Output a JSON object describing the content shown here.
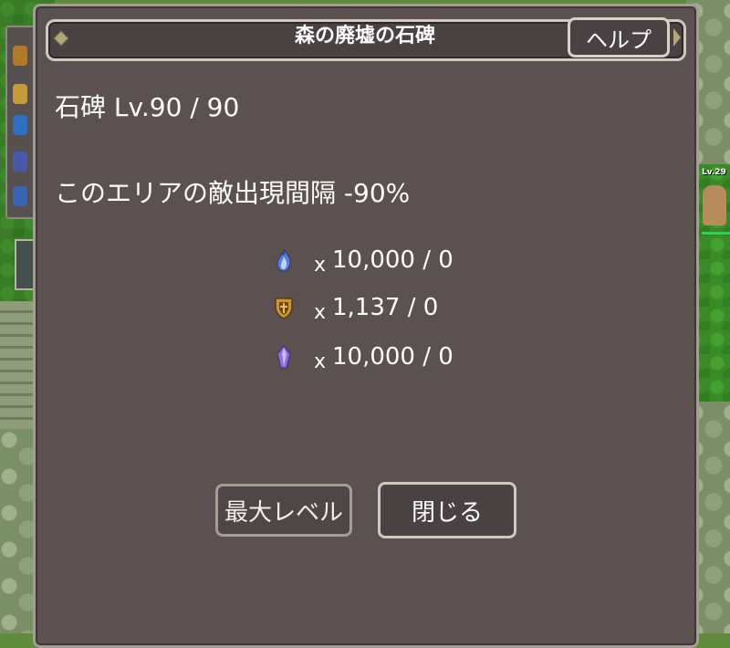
{
  "dialog": {
    "title": "森の廃墟の石碑",
    "help_label": "ヘルプ",
    "level_text": "石碑 Lv.90 / 90",
    "effect_text": "このエリアの敵出現間隔 -90%"
  },
  "costs": [
    {
      "icon": "blue-flame-icon",
      "prefix": "x",
      "amount": "10,000 / 0"
    },
    {
      "icon": "golden-shield-icon",
      "prefix": "x",
      "amount": "1,137 / 0"
    },
    {
      "icon": "purple-crystal-icon",
      "prefix": "x",
      "amount": "10,000 / 0"
    }
  ],
  "buttons": {
    "max_level": "最大レベル",
    "close": "閉じる"
  },
  "world": {
    "npc_level": "Lv.29"
  },
  "colors": {
    "panel_bg": "#5a5150",
    "panel_border": "#a59d92",
    "text": "#ffffff"
  }
}
